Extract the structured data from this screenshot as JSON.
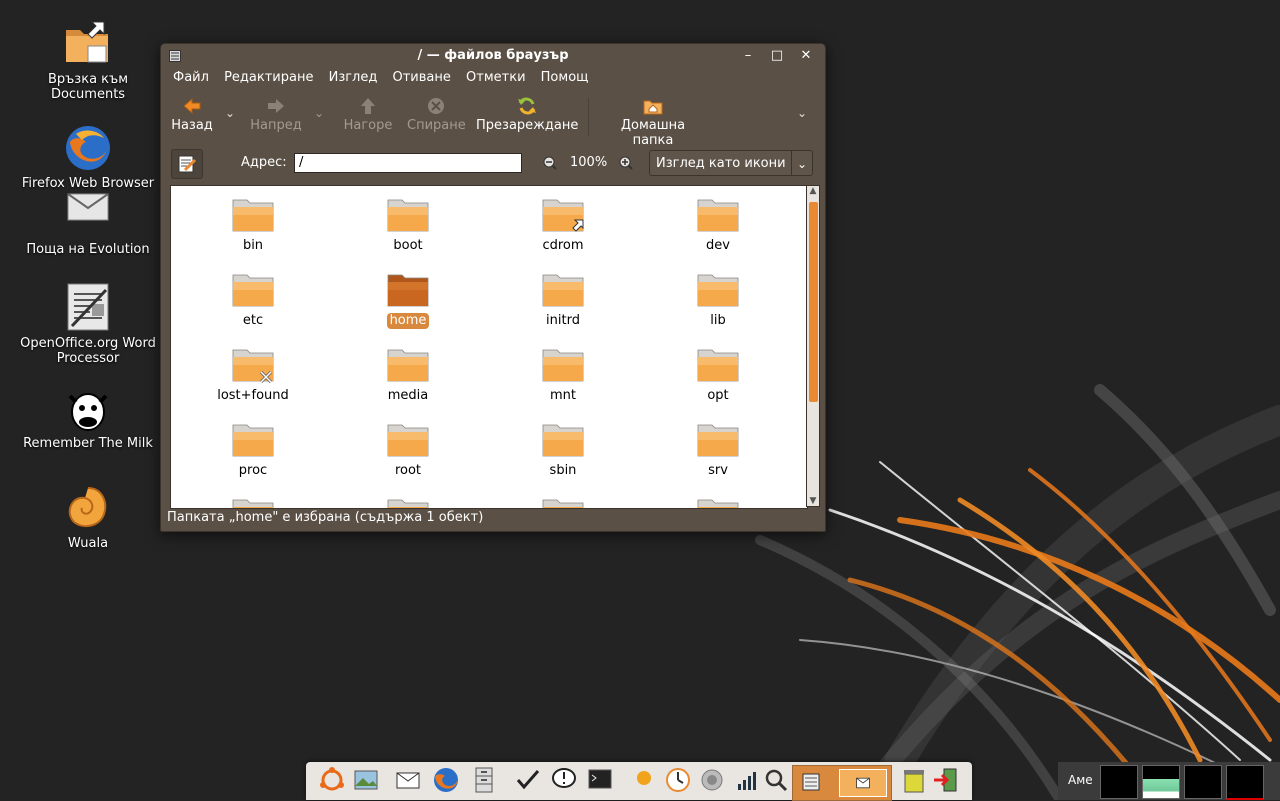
{
  "desktop": {
    "icons": [
      {
        "label": "Връзка към Documents",
        "icon": "folder-link-icon"
      },
      {
        "label": "Firefox Web Browser",
        "icon": "firefox-icon"
      },
      {
        "label": "Поща на Evolution",
        "icon": "mail-icon"
      },
      {
        "label": "OpenOffice.org Word Processor",
        "icon": "writer-icon"
      },
      {
        "label": "Remember The Milk",
        "icon": "cow-icon"
      },
      {
        "label": "Wuala",
        "icon": "shell-icon"
      }
    ]
  },
  "window": {
    "title": "/ — файлов браузър",
    "controls": {
      "minimize": "–",
      "maximize": "□",
      "close": "✕"
    },
    "menu": [
      "Файл",
      "Редактиране",
      "Изглед",
      "Отиване",
      "Отметки",
      "Помощ"
    ],
    "toolbar": {
      "back": "Назад",
      "forward": "Напред",
      "up": "Нагоре",
      "stop": "Спиране",
      "reload": "Презареждане",
      "home": "Домашна папка"
    },
    "location": {
      "label": "Адрес:",
      "value": "/",
      "zoom": "100%",
      "view_mode": "Изглед като икони"
    },
    "files": [
      {
        "name": "bin",
        "emblem": ""
      },
      {
        "name": "boot",
        "emblem": ""
      },
      {
        "name": "cdrom",
        "emblem": "symlink"
      },
      {
        "name": "dev",
        "emblem": ""
      },
      {
        "name": "etc",
        "emblem": ""
      },
      {
        "name": "home",
        "emblem": "selected"
      },
      {
        "name": "initrd",
        "emblem": ""
      },
      {
        "name": "lib",
        "emblem": ""
      },
      {
        "name": "lost+found",
        "emblem": "unreadable"
      },
      {
        "name": "media",
        "emblem": ""
      },
      {
        "name": "mnt",
        "emblem": ""
      },
      {
        "name": "opt",
        "emblem": ""
      },
      {
        "name": "proc",
        "emblem": ""
      },
      {
        "name": "root",
        "emblem": ""
      },
      {
        "name": "sbin",
        "emblem": ""
      },
      {
        "name": "srv",
        "emblem": ""
      }
    ],
    "status": "Папката „home\" е избрана (съдържа 1 обект)"
  },
  "panel": {
    "tray_label": "Аме"
  },
  "colors": {
    "accent": "#e98a33",
    "window_bg": "#5a5046",
    "desktop_bg": "#232323"
  }
}
